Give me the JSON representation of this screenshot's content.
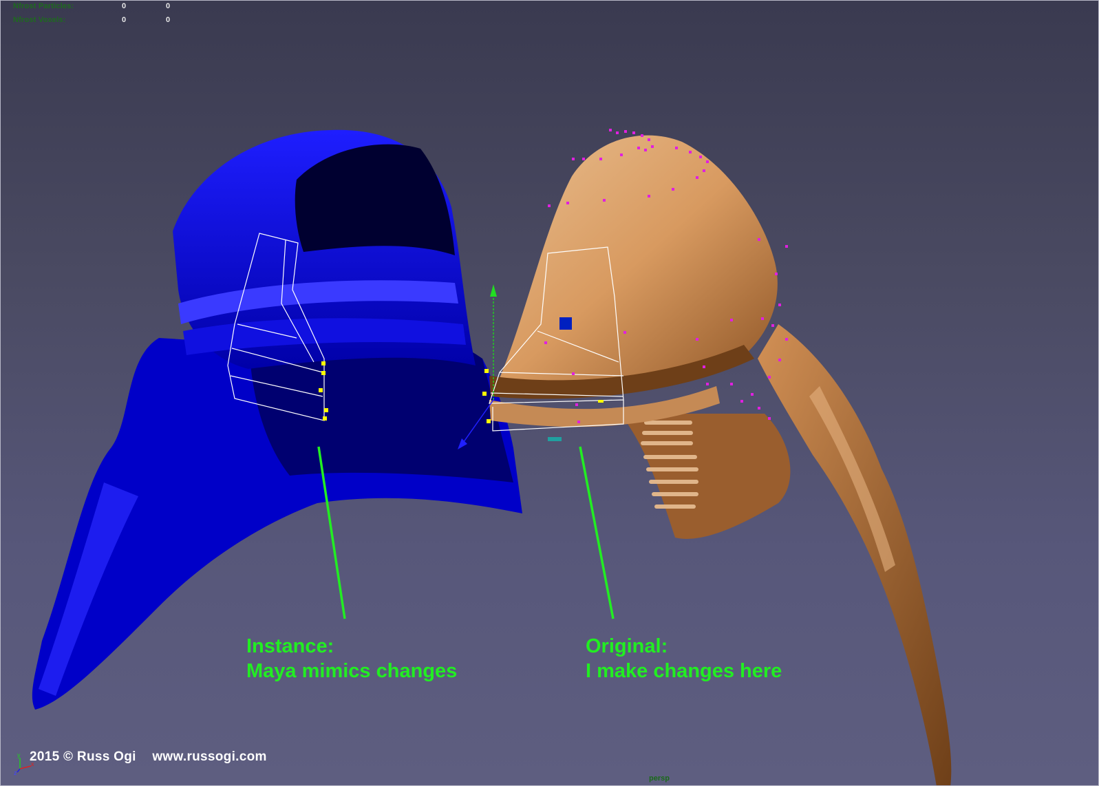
{
  "hud": {
    "particles_label": "Nfrost Particles:",
    "particles_v1": "0",
    "particles_v2": "0",
    "voxels_label": "Nfrost Voxels:",
    "voxels_v1": "0",
    "voxels_v2": "0"
  },
  "annotations": {
    "instance_line1": "Instance:",
    "instance_line2": "Maya mimics changes",
    "original_line1": "Original:",
    "original_line2": "I make changes here"
  },
  "footer": {
    "copyright": "2015 © Russ Ogi",
    "website": "www.russogi.com",
    "camera": "persp"
  },
  "axis": {
    "y": "y",
    "z": "z",
    "x": "x"
  },
  "colors": {
    "background_top": "#3a3a50",
    "background_bottom": "#5e5e80",
    "instance_mesh": "#1a1aff",
    "original_mesh": "#c98a50",
    "annotation": "#22ee22",
    "selection_points": "#e020e0",
    "wireframe": "#ffffff",
    "handles": "#ffff00"
  },
  "objects": {
    "instance": "blue-hood-instance",
    "original": "bronze-hood-original"
  }
}
